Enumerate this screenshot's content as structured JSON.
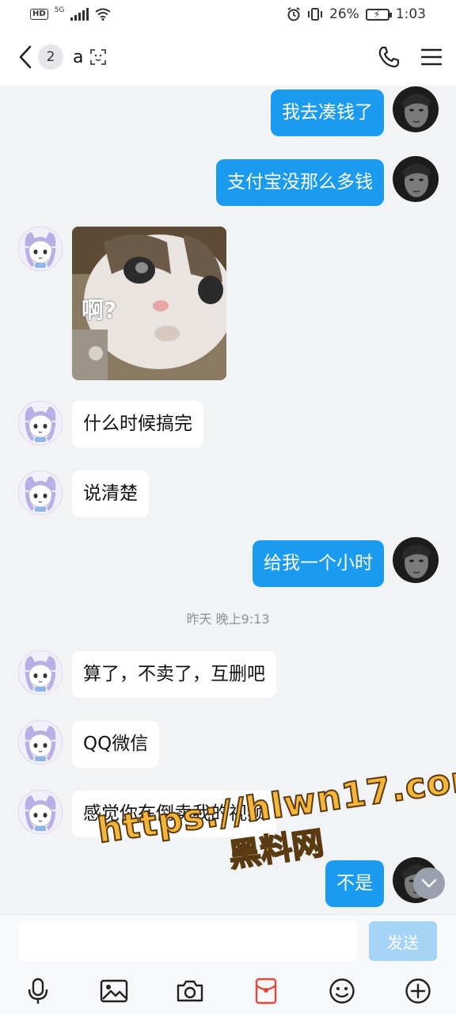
{
  "status_bar": {
    "hd": "HD",
    "network": "5G",
    "battery": "26%",
    "time": "1:03"
  },
  "header": {
    "unread_count": "2",
    "title": "a"
  },
  "messages": [
    {
      "side": "out",
      "text": "我去凑钱了"
    },
    {
      "side": "out",
      "text": "支付宝没那么多钱"
    },
    {
      "side": "in",
      "sticker_text": "啊?"
    },
    {
      "side": "in",
      "text": "什么时候搞完"
    },
    {
      "side": "in",
      "text": "说清楚"
    },
    {
      "side": "out",
      "text": "给我一个小时"
    },
    {
      "side": "in",
      "text": "算了，不卖了，互删吧"
    },
    {
      "side": "in",
      "text": "QQ微信"
    },
    {
      "side": "in",
      "text": "感觉你在倒卖我的视频"
    },
    {
      "side": "out",
      "text": "不是"
    }
  ],
  "timestamp": "昨天 晚上9:13",
  "watermark": {
    "line1": "https://hlwn17.com",
    "line2": "黑料网"
  },
  "input": {
    "value": "",
    "send_label": "发送"
  },
  "toolbar_icons": [
    "microphone-icon",
    "image-icon",
    "camera-icon",
    "red-envelope-icon",
    "emoji-icon",
    "plus-icon"
  ],
  "colors": {
    "outgoing_bubble": "#1a9bf0",
    "incoming_bubble": "#ffffff",
    "background": "#f2f3f5",
    "send_disabled": "#a6d4f7",
    "watermark": "#f3b63a"
  }
}
